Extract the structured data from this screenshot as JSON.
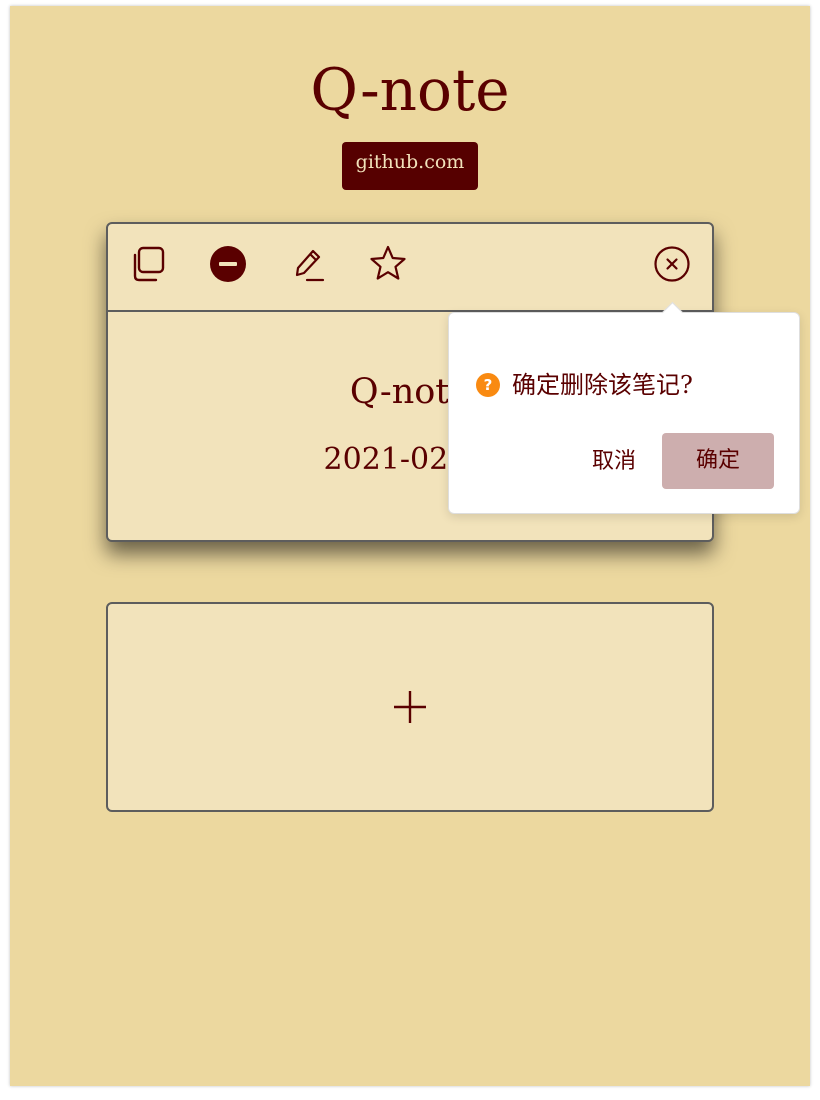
{
  "app": {
    "title": "Q-note",
    "github_link": "github.com"
  },
  "note_card": {
    "title": "Q-note",
    "date": "2021-02-20",
    "toolbar": {
      "icons": [
        "copy-icon",
        "minus-circle-icon",
        "pencil-icon",
        "star-icon",
        "close-circle-icon"
      ]
    }
  },
  "add_card": {
    "icon": "plus-icon"
  },
  "popover": {
    "message": "确定删除该笔记?",
    "icon_glyph": "?",
    "icon_name": "question-circle-icon",
    "cancel_label": "取消",
    "confirm_label": "确定"
  },
  "colors": {
    "background": "#ecd89f",
    "card": "#f2e3bb",
    "accent": "#5a0000",
    "badge": "#560000",
    "warning": "#f98a11",
    "confirm_button": "#cdaeae"
  }
}
